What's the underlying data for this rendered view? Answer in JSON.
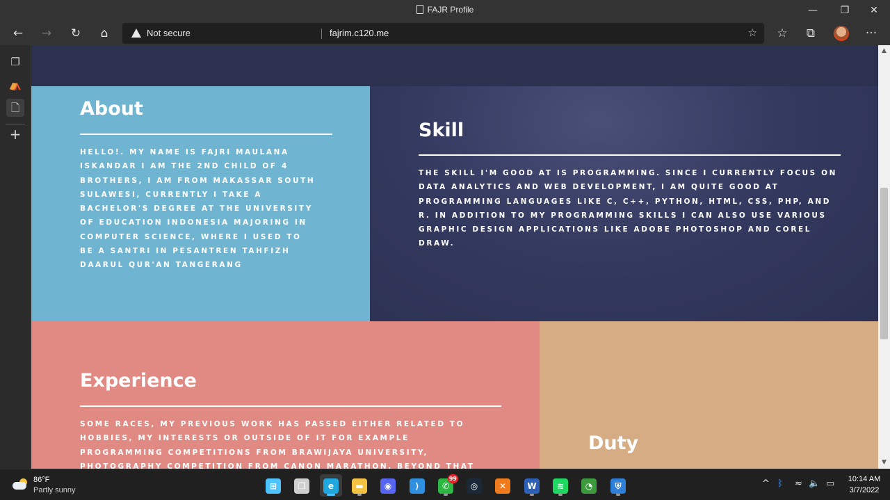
{
  "window": {
    "title": "FAJR Profile",
    "minimize_glyph": "—",
    "restore_glyph": "❐",
    "close_glyph": "✕"
  },
  "toolbar": {
    "back_glyph": "←",
    "forward_glyph": "→",
    "refresh_glyph": "↻",
    "home_glyph": "⌂",
    "security_label": "Not secure",
    "url": "fajrim.c120.me",
    "add_favorite_glyph": "☆",
    "favorites_glyph": "☆",
    "collections_glyph": "⧉",
    "more_glyph": "···"
  },
  "sidebar": {
    "items": [
      {
        "name": "tab-actions-icon",
        "glyph": "❐"
      },
      {
        "name": "profile-app-icon",
        "glyph": "⛺"
      },
      {
        "name": "page-icon",
        "glyph": "🗋"
      },
      {
        "name": "add-icon",
        "glyph": "+"
      }
    ]
  },
  "page": {
    "about": {
      "title": "About",
      "text": "Hello!. My name is Fajri Maulana Iskandar I am the 2nd child of 4 brothers, I am from Makassar South Sulawesi, currently I take a bachelor's degree at the University of Education Indonesia majoring in Computer Science, where I used to be a santri in Pesantren Tahfizh Daarul Qur'an Tangerang"
    },
    "skill": {
      "title": "Skill",
      "text": "The skill I'm good at is programming. Since I currently focus on data analytics and web development, I am quite good at programming languages like C, C++, Python, HTML, CSS, PHP, and R. In addition to my programming skills I can also use various graphic design applications like Adobe Photoshop and Corel Draw."
    },
    "experience": {
      "title": "Experience",
      "text": "Some races, my previous work has passed either related to hobbies, my interests or outside of it for example programming competitions from Brawijaya University, photography competition from Canon Marathon. Beyond that such as"
    },
    "duty": {
      "title": "Duty"
    }
  },
  "scrollbar": {
    "up_glyph": "▲",
    "down_glyph": "▼"
  },
  "taskbar": {
    "weather": {
      "temp": "86°F",
      "desc": "Partly sunny"
    },
    "apps": [
      {
        "name": "start-button",
        "glyph": "⊞",
        "color": "#4cc2ff",
        "running": false
      },
      {
        "name": "task-view-button",
        "glyph": "❐",
        "color": "#cfcfcf",
        "running": false
      },
      {
        "name": "edge-app",
        "glyph": "e",
        "color": "#1fa7e0",
        "running": true
      },
      {
        "name": "file-explorer-app",
        "glyph": "▬",
        "color": "#f4c242",
        "running": true
      },
      {
        "name": "discord-app",
        "glyph": "◉",
        "color": "#5865f2",
        "running": false
      },
      {
        "name": "vscode-app",
        "glyph": "⟩",
        "color": "#2f8fe0",
        "running": false
      },
      {
        "name": "whatsapp-app",
        "glyph": "✆",
        "color": "#2bb741",
        "running": true,
        "badge": "99"
      },
      {
        "name": "steam-app",
        "glyph": "◎",
        "color": "#1b2838",
        "running": false
      },
      {
        "name": "xampp-app",
        "glyph": "✕",
        "color": "#f07b1d",
        "running": false
      },
      {
        "name": "word-app",
        "glyph": "W",
        "color": "#2b5fb8",
        "running": true
      },
      {
        "name": "spotify-app",
        "glyph": "≋",
        "color": "#1ed760",
        "running": true
      },
      {
        "name": "sound-app",
        "glyph": "◔",
        "color": "#3c9a3c",
        "running": false
      },
      {
        "name": "security-app",
        "glyph": "⛨",
        "color": "#2e7fd8",
        "running": true
      }
    ],
    "tray": {
      "chevron_glyph": "^",
      "bluetooth_glyph": "ᛒ",
      "wifi_glyph": "≈",
      "volume_glyph": "🔈",
      "battery_glyph": "▭"
    },
    "clock": {
      "time": "10:14 AM",
      "date": "3/7/2022"
    }
  },
  "colors": {
    "about_bg": "#6fb5d1",
    "skill_bg": "#2f3457",
    "experience_bg": "#e08a83",
    "duty_bg": "#d6ac84",
    "top_band": "#2c3150"
  }
}
